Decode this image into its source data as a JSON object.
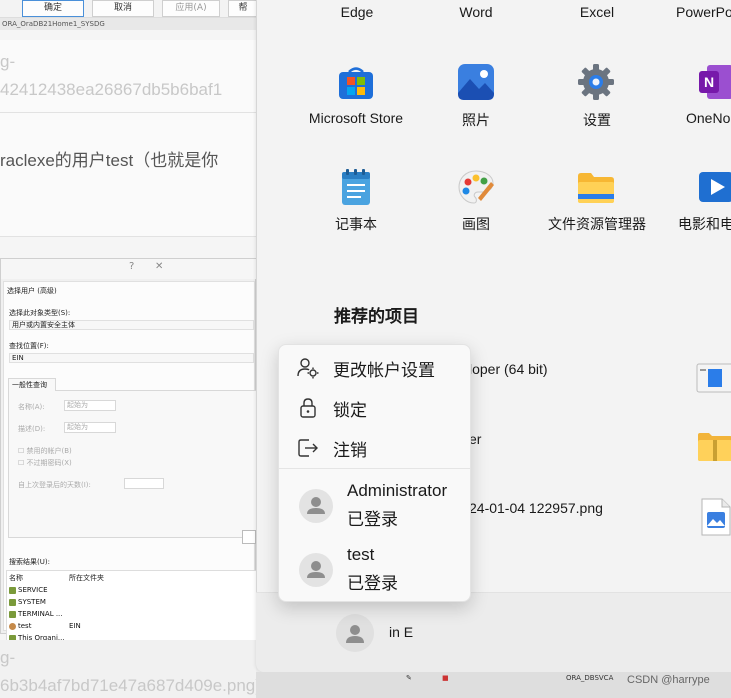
{
  "background_page": {
    "dialog_buttons": [
      "确定",
      "取消",
      "应用(A)",
      "帮"
    ],
    "path_line": "ORA_OraDB21Home1_SYSDG",
    "faded_line_1": "g-",
    "faded_line_2": "42412438ea26867db5b6baf1",
    "body_line": "raclexe的用户test（也就是你",
    "faded_line_3": "g-",
    "faded_line_4": "6b3b4af7bd71e47a687d409e.png)"
  },
  "select_user_dialog": {
    "help_btn": "?",
    "close_btn": "✕",
    "title": "选择用户 (高级)",
    "object_type_label": "选择此对象类型(S):",
    "object_type_value": "用户或内置安全主体",
    "location_label": "查找位置(F):",
    "location_value": "EIN",
    "tab_label": "一般性查询",
    "name_label": "名称(A):",
    "name_op": "起始为",
    "desc_label": "描述(D):",
    "desc_op": "起始为",
    "disabled_label": "禁用的帐户(B)",
    "no_expire_label": "不过期密码(X)",
    "days_label": "自上次登录后的天数(I):",
    "results_label": "搜索结果(U):",
    "col_name": "名称",
    "col_folder": "所在文件夹",
    "results": [
      {
        "name": "SERVICE",
        "folder": ""
      },
      {
        "name": "SYSTEM",
        "folder": ""
      },
      {
        "name": "TERMINAL ...",
        "folder": ""
      },
      {
        "name": "test",
        "folder": "EIN"
      },
      {
        "name": "This Organi...",
        "folder": ""
      }
    ]
  },
  "start_menu": {
    "top_apps": [
      "Edge",
      "Word",
      "Excel",
      "PowerPo"
    ],
    "apps_row1": [
      "Microsoft Store",
      "照片",
      "设置",
      "OneNo"
    ],
    "apps_row2": [
      "记事本",
      "画图",
      "文件资源管理器",
      "电影和电"
    ],
    "recommended_title": "推荐的项目",
    "recommended": [
      {
        "text": "loper (64 bit)",
        "icon": "installer-icon"
      },
      {
        "text": "er",
        "icon": "folder-zip-icon"
      },
      {
        "text": "24-01-04 122957.png",
        "icon": "image-file-icon"
      }
    ],
    "current_user_label": "in E"
  },
  "user_flyout": {
    "menu": [
      {
        "label": "更改帐户设置",
        "icon": "account-settings-icon"
      },
      {
        "label": "锁定",
        "icon": "lock-icon"
      },
      {
        "label": "注销",
        "icon": "sign-out-icon"
      }
    ],
    "accounts": [
      {
        "name": "Administrator",
        "status": "已登录"
      },
      {
        "name": "test",
        "status": "已登录"
      }
    ]
  },
  "taskbar": {
    "item_label": "ORA_DBSVCA",
    "watermark": "CSDN @harrype"
  },
  "colors": {
    "start_bg": "#f3f3f3",
    "flyout_bg": "#f9f9f9",
    "accent": "#0067c0"
  }
}
